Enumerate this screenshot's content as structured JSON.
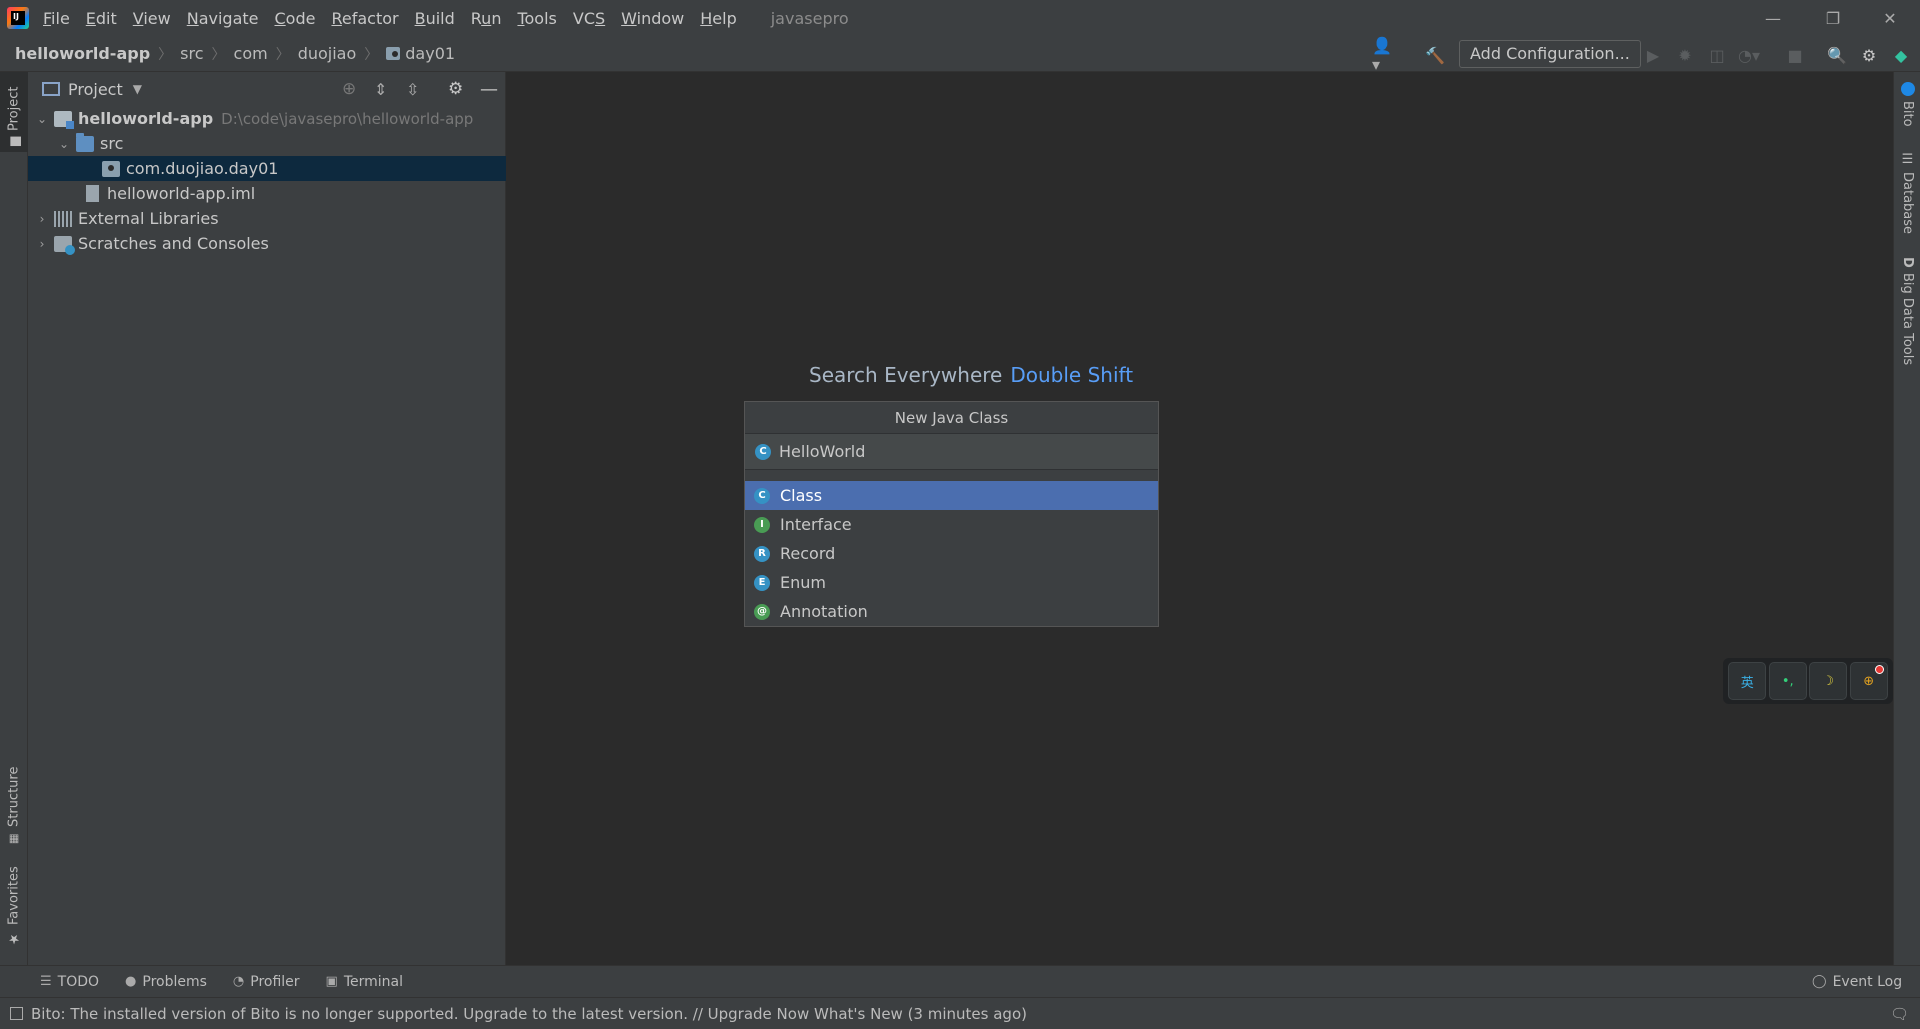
{
  "titlebar": {
    "menu": [
      {
        "label": "File",
        "mn": "F"
      },
      {
        "label": "Edit",
        "mn": "E"
      },
      {
        "label": "View",
        "mn": "V"
      },
      {
        "label": "Navigate",
        "mn": "N"
      },
      {
        "label": "Code",
        "mn": "C"
      },
      {
        "label": "Refactor",
        "mn": "R"
      },
      {
        "label": "Build",
        "mn": "B"
      },
      {
        "label": "Run",
        "mn": "u"
      },
      {
        "label": "Tools",
        "mn": "T"
      },
      {
        "label": "VCS",
        "mn": "S"
      },
      {
        "label": "Window",
        "mn": "W"
      },
      {
        "label": "Help",
        "mn": "H"
      }
    ],
    "project_name": "javasepro"
  },
  "navbar": {
    "breadcrumbs": [
      "helloworld-app",
      "src",
      "com",
      "duojiao",
      "day01"
    ],
    "run_config_label": "Add Configuration..."
  },
  "left_tabs": {
    "project": "Project",
    "structure": "Structure",
    "favorites": "Favorites"
  },
  "right_tabs": {
    "bito": "Bito",
    "database": "Database",
    "big_data_tools": "Big Data Tools"
  },
  "project_panel": {
    "title": "Project",
    "tree": [
      {
        "label": "helloworld-app",
        "hint": "D:\\code\\javasepro\\helloworld-app"
      },
      {
        "label": "src"
      },
      {
        "label": "com.duojiao.day01"
      },
      {
        "label": "helloworld-app.iml"
      },
      {
        "label": "External Libraries"
      },
      {
        "label": "Scratches and Consoles"
      }
    ]
  },
  "editor": {
    "hint_text": "Search Everywhere",
    "hint_shortcut": "Double Shift"
  },
  "new_class_popup": {
    "title": "New Java Class",
    "name_value": "HelloWorld",
    "kinds": [
      {
        "label": "Class",
        "badge": "C",
        "color": "#3592c4"
      },
      {
        "label": "Interface",
        "badge": "I",
        "color": "#499c54"
      },
      {
        "label": "Record",
        "badge": "R",
        "color": "#3592c4"
      },
      {
        "label": "Enum",
        "badge": "E",
        "color": "#3592c4"
      },
      {
        "label": "Annotation",
        "badge": "@",
        "color": "#499c54"
      }
    ],
    "selected_index": 0
  },
  "floating_widget": {
    "button1": "英",
    "button2": "•,",
    "button3": "☽",
    "button4": "⊕"
  },
  "bottom_tabs": {
    "todo": "TODO",
    "problems": "Problems",
    "profiler": "Profiler",
    "terminal": "Terminal",
    "event_log": "Event Log"
  },
  "status": {
    "message": "Bito: The installed version of Bito is no longer supported. Upgrade to the latest version. // Upgrade Now   What's New (3 minutes ago)"
  },
  "colors": {
    "accent": "#4b6eaf",
    "selection": "#0d293e",
    "link": "#589df6"
  }
}
